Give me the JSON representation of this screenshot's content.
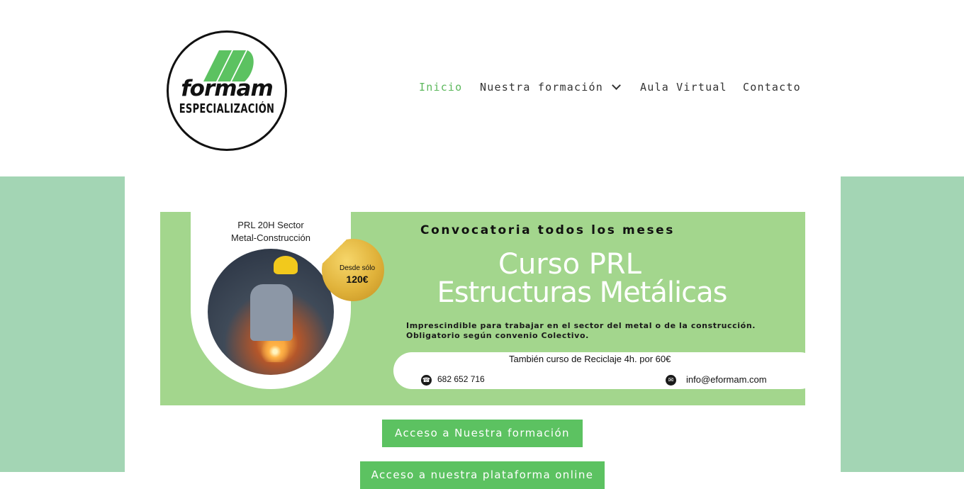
{
  "brand": {
    "logo_word": "formam",
    "logo_sub": "ESPECIALIZACIÓN",
    "accent_color": "#5cc261",
    "background_color": "#a3d5b4"
  },
  "nav": {
    "items": [
      {
        "label": "Inicio",
        "active": true
      },
      {
        "label": "Nuestra formación",
        "has_dropdown": true
      },
      {
        "label": "Aula Virtual"
      },
      {
        "label": "Contacto"
      }
    ]
  },
  "banner": {
    "photo_title_1": "PRL 20H Sector",
    "photo_title_2": "Metal-Construcción",
    "price_label": "Desde sólo",
    "price_value": "120€",
    "headline": "Convocatoria todos los meses",
    "title_1": "Curso PRL",
    "title_2": "Estructuras Metálicas",
    "description_1": "Imprescindible para trabajar en el sector del metal o de la construcción.",
    "description_2": "Obligatorio según convenio Colectivo.",
    "recycling": "También curso de Reciclaje 4h.  por 60€",
    "phone": "682 652 716",
    "email": "info@eformam.com",
    "phone_icon": "phone-icon",
    "email_icon": "envelope-icon"
  },
  "buttons": {
    "primary": "Acceso a Nuestra formación",
    "secondary": "Acceso a nuestra plataforma online"
  }
}
